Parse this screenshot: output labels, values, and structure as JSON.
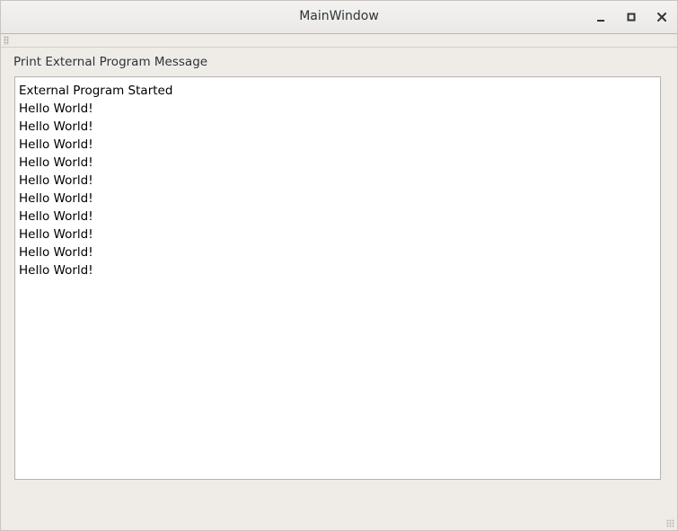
{
  "window": {
    "title": "MainWindow",
    "controls": {
      "minimize_icon": "minimize-icon",
      "maximize_icon": "maximize-icon",
      "close_icon": "close-icon"
    }
  },
  "main": {
    "label": "Print External Program Message",
    "output_lines": [
      "External Program Started",
      "Hello World!",
      "Hello World!",
      "Hello World!",
      "Hello World!",
      "Hello World!",
      "Hello World!",
      "Hello World!",
      "Hello World!",
      "Hello World!",
      "Hello World!"
    ]
  },
  "colors": {
    "window_bg": "#efebe7",
    "titlebar_bg": "#f3f2f1",
    "text": "#2e3436",
    "textarea_bg": "#ffffff"
  }
}
